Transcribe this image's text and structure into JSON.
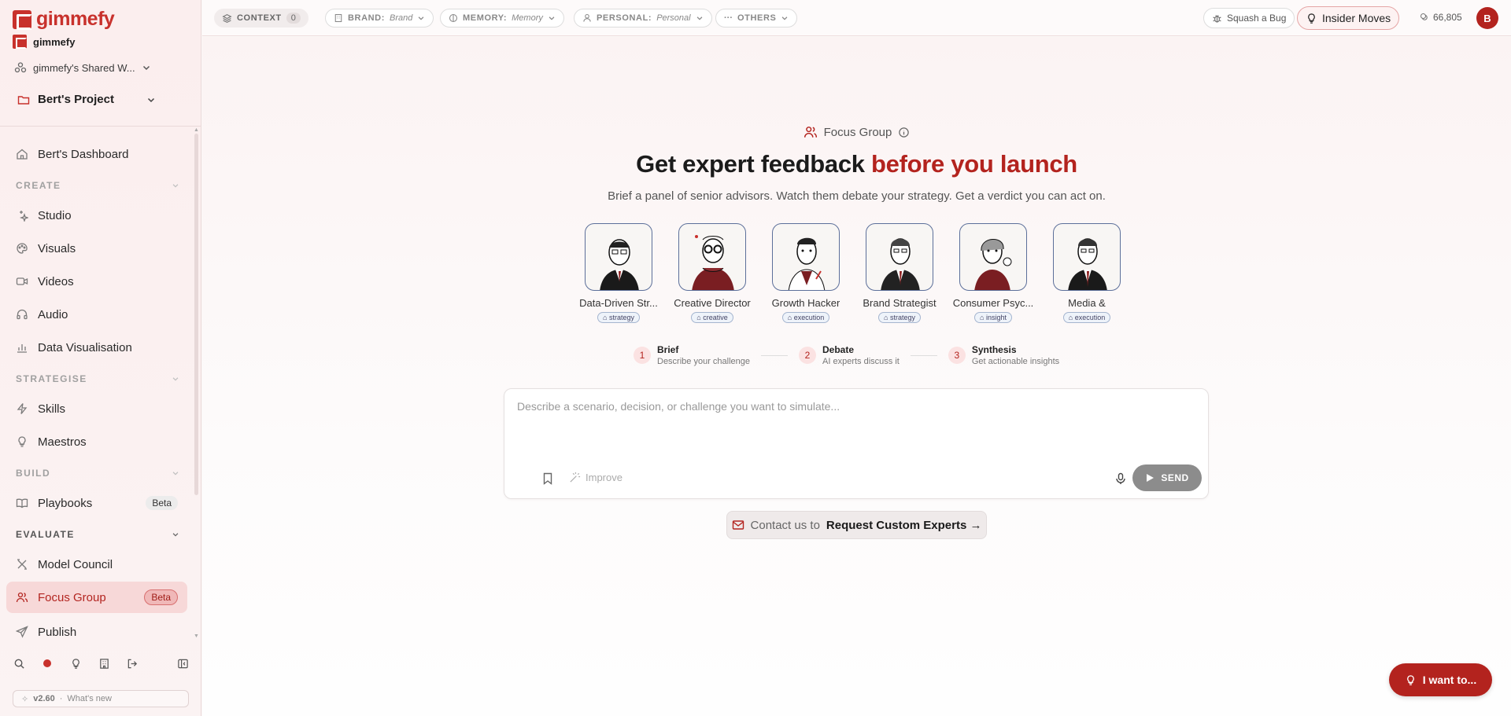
{
  "app": {
    "brand": "gimmefy",
    "org": "gimmefy",
    "workspace": "gimmefy's Shared W...",
    "project": "Bert's Project"
  },
  "sidebar": {
    "dashboard": "Bert's Dashboard",
    "sections": {
      "create": "CREATE",
      "strategise": "STRATEGISE",
      "build": "BUILD",
      "evaluate": "EVALUATE"
    },
    "items": {
      "studio": "Studio",
      "visuals": "Visuals",
      "videos": "Videos",
      "audio": "Audio",
      "data_visualisation": "Data Visualisation",
      "skills": "Skills",
      "maestros": "Maestros",
      "playbooks": "Playbooks",
      "playbooks_badge": "Beta",
      "model_council": "Model Council",
      "focus_group": "Focus Group",
      "focus_group_badge": "Beta",
      "publish": "Publish"
    },
    "version": "v2.60",
    "whats_new": "What's new"
  },
  "topbar": {
    "context_label": "CONTEXT",
    "context_count": "0",
    "brand_label": "BRAND:",
    "brand_value": "Brand",
    "memory_label": "MEMORY:",
    "memory_value": "Memory",
    "personal_label": "PERSONAL:",
    "personal_value": "Personal",
    "others_label": "OTHERS",
    "squash_bug": "Squash a Bug",
    "insider_moves": "Insider Moves",
    "credits": "66,805",
    "avatar_initial": "B"
  },
  "main": {
    "mode": "Focus Group",
    "headline_plain": "Get expert feedback",
    "headline_accent": "before you launch",
    "subline": "Brief a panel of senior advisors. Watch them debate your strategy. Get a verdict you can act on.",
    "experts": [
      {
        "name": "Data-Driven Str...",
        "tag": "strategy"
      },
      {
        "name": "Creative Director",
        "tag": "creative"
      },
      {
        "name": "Growth Hacker",
        "tag": "execution"
      },
      {
        "name": "Brand Strategist",
        "tag": "strategy"
      },
      {
        "name": "Consumer Psyc...",
        "tag": "insight"
      },
      {
        "name": "Media &",
        "tag": "execution"
      }
    ],
    "steps": [
      {
        "num": "1",
        "title": "Brief",
        "desc": "Describe your challenge"
      },
      {
        "num": "2",
        "title": "Debate",
        "desc": "AI experts discuss it"
      },
      {
        "num": "3",
        "title": "Synthesis",
        "desc": "Get actionable insights"
      }
    ],
    "composer": {
      "placeholder": "Describe a scenario, decision, or challenge you want to simulate...",
      "improve": "Improve",
      "send": "SEND"
    },
    "contact_prefix": "Contact us to",
    "contact_action": "Request Custom Experts →",
    "i_want_to": "I want to..."
  },
  "colors": {
    "accent": "#b3231e",
    "brand": "#c8312c",
    "active_bg": "#f7d8d8"
  }
}
